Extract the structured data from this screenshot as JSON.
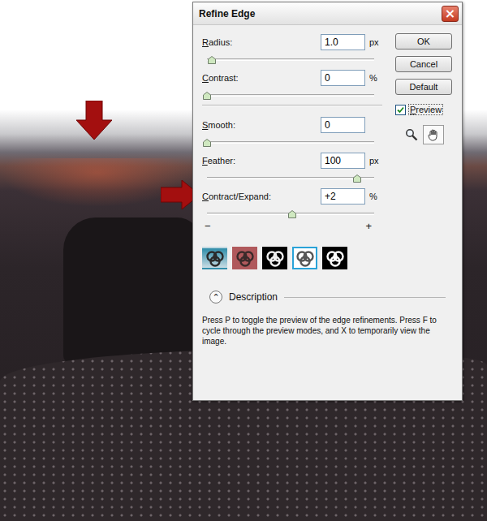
{
  "window": {
    "title": "Refine Edge",
    "close": "×"
  },
  "edge_sliders": [
    {
      "label": "Radius:",
      "value": "1.0",
      "unit": "px",
      "level": 0.03
    },
    {
      "label": "Contrast:",
      "value": "0",
      "unit": "%",
      "level": 0
    }
  ],
  "adjust_sliders": [
    {
      "label": "Smooth:",
      "value": "0",
      "unit": "",
      "level": 0
    },
    {
      "label": "Feather:",
      "value": "100",
      "unit": "px",
      "level": 0.9
    },
    {
      "label": "Contract/Expand:",
      "value": "+2",
      "unit": "%",
      "level": 0.51,
      "min_label": "−",
      "max_label": "+"
    }
  ],
  "preview_modes": [
    {
      "selected": false
    },
    {
      "selected": false
    },
    {
      "selected": false
    },
    {
      "selected": true
    },
    {
      "selected": false
    }
  ],
  "buttons": [
    "OK",
    "Cancel",
    "Default"
  ],
  "preview": {
    "label": "Preview",
    "checked": true
  },
  "description": {
    "toggle": "⌃",
    "title": "Description",
    "text": "Press P to toggle the preview of the edge refinements. Press F to cycle through the preview modes, and X to temporarily view the image."
  }
}
